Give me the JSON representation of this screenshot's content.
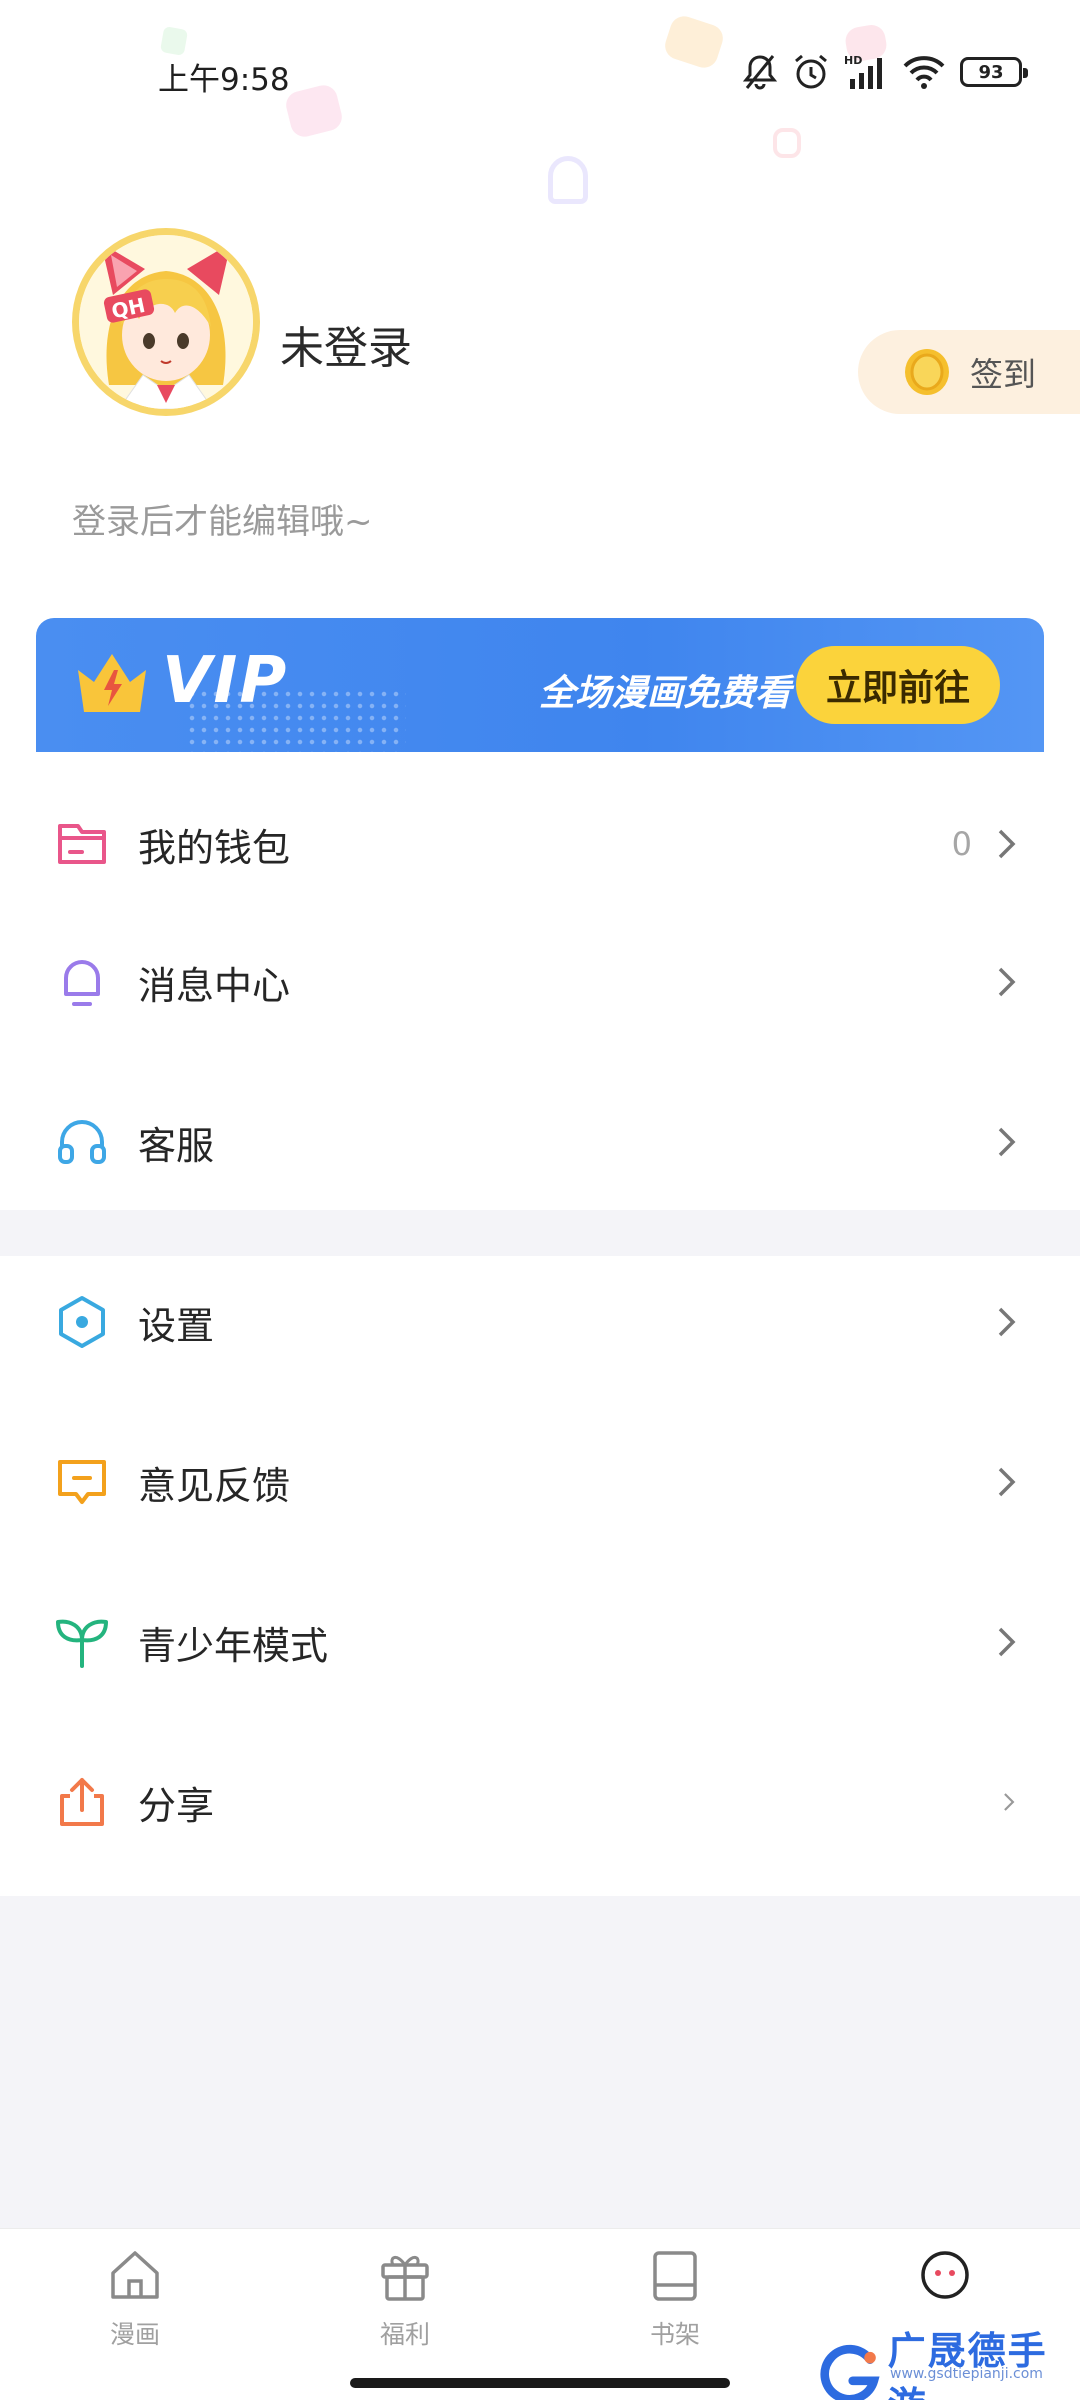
{
  "status_bar": {
    "time": "上午9:58",
    "battery": "93",
    "icons": [
      "mute-bell-icon",
      "alarm-icon",
      "hd-signal-icon",
      "wifi-icon",
      "battery-icon"
    ]
  },
  "profile": {
    "username": "未登录",
    "avatar_icon": "anime-cat-girl-avatar",
    "bio": "登录后才能编辑哦~",
    "signin_label": "签到",
    "signin_icon": "coin-icon"
  },
  "vip_banner": {
    "title": "VIP",
    "tagline": "全场漫画免费看",
    "button_label": "立即前往",
    "icon": "crown-icon",
    "color": "#438AF0",
    "button_color": "#FBD33B"
  },
  "menu": {
    "group1": [
      {
        "label": "我的钱包",
        "icon": "wallet-icon",
        "color": "#E9568A",
        "value": "0"
      },
      {
        "label": "消息中心",
        "icon": "bell-icon",
        "color": "#9A7BEA"
      },
      {
        "label": "客服",
        "icon": "headset-icon",
        "color": "#3EA7E6"
      }
    ],
    "group2": [
      {
        "label": "设置",
        "icon": "settings-hexagon-icon",
        "color": "#39A9E0"
      },
      {
        "label": "意见反馈",
        "icon": "feedback-icon",
        "color": "#F3A11C"
      },
      {
        "label": "青少年模式",
        "icon": "sprout-icon",
        "color": "#24B47E"
      },
      {
        "label": "分享",
        "icon": "share-icon",
        "color": "#F2794A"
      }
    ]
  },
  "tabbar": {
    "tabs": [
      {
        "label": "漫画",
        "icon": "home-icon"
      },
      {
        "label": "福利",
        "icon": "gift-icon"
      },
      {
        "label": "书架",
        "icon": "bookshelf-icon"
      },
      {
        "label": "",
        "icon": "profile-face-icon",
        "active": true
      }
    ]
  },
  "watermark": {
    "text": "广晟德手游",
    "sub": "www.gsdtiepianji.com"
  }
}
